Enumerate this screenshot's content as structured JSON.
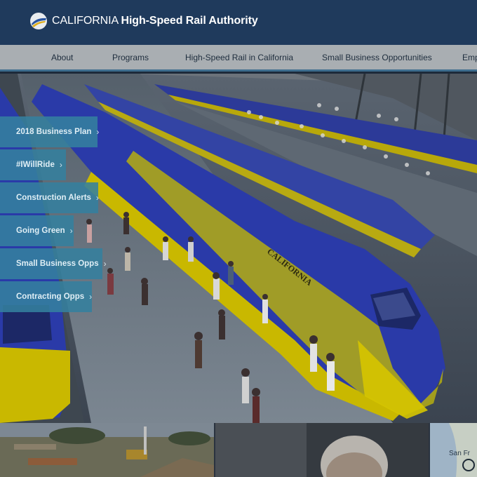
{
  "header": {
    "logo_state": "CALIFORNIA",
    "logo_org": "High-Speed Rail Authority",
    "logo_icon": "hsr-logo-icon"
  },
  "nav": {
    "items": [
      {
        "label": "About"
      },
      {
        "label": "Programs"
      },
      {
        "label": "High-Speed Rail in California"
      },
      {
        "label": "Small Business Opportunities"
      },
      {
        "label": "Emp"
      }
    ]
  },
  "hero": {
    "image": "high-speed-train-station-rendering",
    "train_lettering": "CALIFORNIA",
    "side_links": [
      {
        "label": "2018 Business Plan"
      },
      {
        "label": "#IWillRide"
      },
      {
        "label": "Construction Alerts"
      },
      {
        "label": "Going Green"
      },
      {
        "label": "Small Business Opps"
      },
      {
        "label": "Contracting Opps"
      }
    ],
    "chevron": "›"
  },
  "strip": {
    "tiles": [
      {
        "image": "construction-site-photo"
      },
      {
        "image": "person-portrait-photo"
      },
      {
        "image": "map-thumbnail",
        "label": "San Fr"
      }
    ]
  },
  "colors": {
    "header_bg": "#1f3a5c",
    "nav_bg": "#a9aeb2",
    "side_button_bg": "#34809e",
    "train_blue": "#2a3aa8",
    "train_yellow": "#c9b800"
  }
}
